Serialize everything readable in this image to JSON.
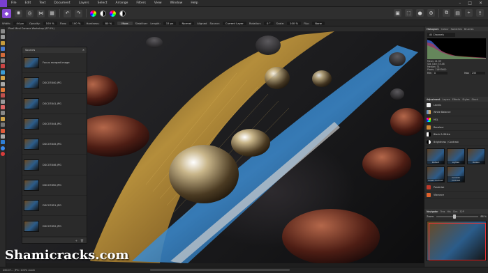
{
  "menubar": {
    "items": [
      "File",
      "Edit",
      "Text",
      "Document",
      "Layers",
      "Select",
      "Arrange",
      "Filters",
      "View",
      "Window",
      "Help"
    ],
    "window_controls": [
      "–",
      "□",
      "✕"
    ]
  },
  "context_bar": {
    "width_label": "Width:",
    "width_value": "44 px",
    "opacity_label": "Opacity:",
    "opacity_value": "100 %",
    "flow_label": "Flow:",
    "flow_value": "100 %",
    "hardness_label": "Hardness:",
    "hardness_value": "80 %",
    "more_label": "More",
    "stabiliser_label": "Stabiliser",
    "length_label": "Length:",
    "length_value": "15 px",
    "mode_value": "Normal",
    "aligned_label": "Aligned",
    "source_label": "Source:",
    "source_value": "Current Layer",
    "rotation_label": "Rotation:",
    "rotation_value": "0 °",
    "scale_label": "Scale:",
    "scale_value": "100 %",
    "flip_label": "Flip:",
    "flip_value": "None"
  },
  "document_tab": "Pixel Mind Camera Workshop (87.0%)",
  "sources_panel": {
    "title": "Sources",
    "items": [
      "Focus merged image",
      "DSC07840.JPG",
      "DSC07841.JPG",
      "DSC07844.JPG",
      "DSC07845.JPG",
      "DSC07846.JPG",
      "DSC07850.JPG",
      "DSC07851.JPG",
      "DSC07852.JPG",
      "DSC07853.JPG"
    ],
    "footer_icons": [
      "+",
      "🗑"
    ]
  },
  "studio": {
    "histogram_tabs": [
      "Histogram",
      "Colour",
      "Swatches",
      "Brushes"
    ],
    "histogram_select": "All Channels",
    "histogram_stats": [
      "Mean: 41.99",
      "Std. Dev: 33.48",
      "Median: 31",
      "Pixels: 11897600"
    ],
    "min_label": "Min",
    "min_value": "0",
    "max_label": "Max",
    "max_value": "255",
    "adjustment_tabs": [
      "Adjustment",
      "Layers",
      "Effects",
      "Styles",
      "Stock"
    ],
    "adjustments": [
      "Levels",
      "White Balance",
      "HSL",
      "Recolour",
      "Black & White",
      "Brightness / Contrast"
    ],
    "swatch_labels": [
      "Default",
      "Lighten",
      "Darken",
      "Lower Contrast",
      "Increase Contrast"
    ],
    "more_adjustments": [
      "Posterise",
      "Vibrance"
    ],
    "navigator_tabs": [
      "Navigator",
      "Trns",
      "His",
      "Chn",
      "32P"
    ],
    "zoom_label": "Zoom:",
    "zoom_value": "88 %"
  },
  "status": {
    "text": "DSC07... JPG: 100% zoom"
  },
  "watermark": "Shamicracks.com"
}
